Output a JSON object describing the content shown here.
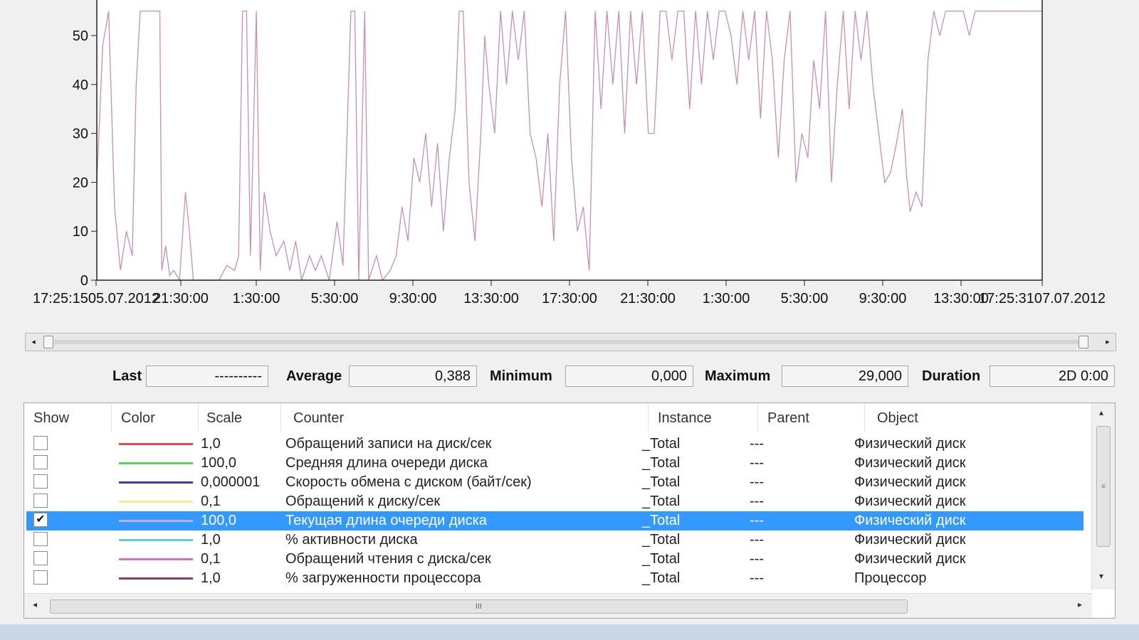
{
  "chart": {
    "y_ticks": [
      "0",
      "10",
      "20",
      "30",
      "40",
      "50"
    ],
    "x_ticks": [
      "17:25:1505.07.2012",
      "21:30:00",
      "1:30:00",
      "5:30:00",
      "9:30:00",
      "13:30:00",
      "17:30:00",
      "21:30:00",
      "1:30:00",
      "5:30:00",
      "9:30:00",
      "13:30:00",
      "17:25:3107.07.2012"
    ],
    "line_color": "#c58fb6"
  },
  "chart_data": {
    "type": "line",
    "ylim": [
      0,
      55
    ],
    "xlim": [
      0,
      48
    ],
    "x_unit": "hours since 17:25:15 05.07.2012",
    "series": [
      {
        "values": [
          [
            0.0,
            20
          ],
          [
            0.3,
            48
          ],
          [
            0.6,
            55
          ],
          [
            0.9,
            15
          ],
          [
            1.2,
            2
          ],
          [
            1.5,
            10
          ],
          [
            1.8,
            5
          ],
          [
            2.0,
            40
          ],
          [
            2.2,
            55
          ],
          [
            2.5,
            55
          ],
          [
            2.9,
            55
          ],
          [
            3.2,
            55
          ],
          [
            3.3,
            2
          ],
          [
            3.5,
            7
          ],
          [
            3.7,
            1
          ],
          [
            3.9,
            2
          ],
          [
            4.2,
            0
          ],
          [
            4.5,
            18
          ],
          [
            4.7,
            10
          ],
          [
            4.9,
            0
          ],
          [
            5.5,
            0
          ],
          [
            6.2,
            0
          ],
          [
            6.6,
            3
          ],
          [
            7.0,
            2
          ],
          [
            7.2,
            5
          ],
          [
            7.4,
            55
          ],
          [
            7.6,
            55
          ],
          [
            7.8,
            5
          ],
          [
            8.1,
            55
          ],
          [
            8.3,
            2
          ],
          [
            8.5,
            18
          ],
          [
            8.8,
            10
          ],
          [
            9.1,
            5
          ],
          [
            9.5,
            8
          ],
          [
            9.8,
            2
          ],
          [
            10.1,
            8
          ],
          [
            10.4,
            0
          ],
          [
            10.8,
            5
          ],
          [
            11.1,
            2
          ],
          [
            11.4,
            5
          ],
          [
            11.8,
            0
          ],
          [
            12.2,
            12
          ],
          [
            12.5,
            3
          ],
          [
            12.9,
            55
          ],
          [
            13.1,
            55
          ],
          [
            13.3,
            0
          ],
          [
            13.6,
            55
          ],
          [
            13.8,
            0
          ],
          [
            14.2,
            5
          ],
          [
            14.5,
            0
          ],
          [
            14.9,
            2
          ],
          [
            15.2,
            5
          ],
          [
            15.5,
            15
          ],
          [
            15.8,
            8
          ],
          [
            16.1,
            25
          ],
          [
            16.4,
            20
          ],
          [
            16.7,
            30
          ],
          [
            17.0,
            15
          ],
          [
            17.3,
            28
          ],
          [
            17.6,
            10
          ],
          [
            17.9,
            25
          ],
          [
            18.2,
            35
          ],
          [
            18.4,
            55
          ],
          [
            18.6,
            55
          ],
          [
            18.9,
            20
          ],
          [
            19.2,
            8
          ],
          [
            19.5,
            30
          ],
          [
            19.7,
            50
          ],
          [
            19.9,
            40
          ],
          [
            20.2,
            30
          ],
          [
            20.5,
            55
          ],
          [
            20.8,
            40
          ],
          [
            21.1,
            55
          ],
          [
            21.4,
            45
          ],
          [
            21.7,
            55
          ],
          [
            22.0,
            30
          ],
          [
            22.3,
            25
          ],
          [
            22.6,
            15
          ],
          [
            22.9,
            30
          ],
          [
            23.2,
            8
          ],
          [
            23.5,
            40
          ],
          [
            23.8,
            55
          ],
          [
            24.1,
            25
          ],
          [
            24.4,
            10
          ],
          [
            24.7,
            15
          ],
          [
            25.0,
            2
          ],
          [
            25.3,
            55
          ],
          [
            25.6,
            35
          ],
          [
            25.9,
            55
          ],
          [
            26.2,
            40
          ],
          [
            26.5,
            55
          ],
          [
            26.8,
            30
          ],
          [
            27.1,
            55
          ],
          [
            27.4,
            40
          ],
          [
            27.7,
            55
          ],
          [
            28.0,
            30
          ],
          [
            28.3,
            30
          ],
          [
            28.6,
            55
          ],
          [
            28.9,
            55
          ],
          [
            29.2,
            45
          ],
          [
            29.5,
            55
          ],
          [
            29.8,
            55
          ],
          [
            30.1,
            35
          ],
          [
            30.4,
            55
          ],
          [
            30.7,
            40
          ],
          [
            31.0,
            55
          ],
          [
            31.3,
            45
          ],
          [
            31.6,
            55
          ],
          [
            31.9,
            55
          ],
          [
            32.2,
            50
          ],
          [
            32.5,
            40
          ],
          [
            32.8,
            55
          ],
          [
            33.1,
            45
          ],
          [
            33.4,
            55
          ],
          [
            33.7,
            33
          ],
          [
            34.0,
            55
          ],
          [
            34.3,
            45
          ],
          [
            34.6,
            25
          ],
          [
            34.9,
            45
          ],
          [
            35.2,
            55
          ],
          [
            35.5,
            20
          ],
          [
            35.8,
            30
          ],
          [
            36.1,
            25
          ],
          [
            36.4,
            45
          ],
          [
            36.7,
            35
          ],
          [
            37.0,
            55
          ],
          [
            37.3,
            20
          ],
          [
            37.6,
            40
          ],
          [
            37.9,
            55
          ],
          [
            38.2,
            35
          ],
          [
            38.5,
            55
          ],
          [
            38.8,
            45
          ],
          [
            39.1,
            55
          ],
          [
            39.4,
            40
          ],
          [
            39.7,
            30
          ],
          [
            40.0,
            20
          ],
          [
            40.3,
            22
          ],
          [
            40.6,
            28
          ],
          [
            40.9,
            35
          ],
          [
            41.1,
            22
          ],
          [
            41.3,
            14
          ],
          [
            41.6,
            18
          ],
          [
            41.9,
            15
          ],
          [
            42.2,
            45
          ],
          [
            42.5,
            55
          ],
          [
            42.8,
            50
          ],
          [
            43.1,
            55
          ],
          [
            43.4,
            55
          ],
          [
            43.7,
            55
          ],
          [
            44.0,
            55
          ],
          [
            44.3,
            50
          ],
          [
            44.6,
            55
          ],
          [
            45.0,
            55
          ],
          [
            45.5,
            55
          ],
          [
            46.0,
            55
          ],
          [
            46.5,
            55
          ],
          [
            47.0,
            55
          ],
          [
            47.5,
            55
          ],
          [
            48.0,
            55
          ]
        ]
      }
    ]
  },
  "stats": {
    "last_label": "Last",
    "last_value": "----------",
    "average_label": "Average",
    "average_value": "0,388",
    "minimum_label": "Minimum",
    "minimum_value": "0,000",
    "maximum_label": "Maximum",
    "maximum_value": "29,000",
    "duration_label": "Duration",
    "duration_value": "2D 0:00"
  },
  "legend": {
    "headers": {
      "show": "Show",
      "color": "Color",
      "scale": "Scale",
      "counter": "Counter",
      "instance": "Instance",
      "parent": "Parent",
      "object": "Object"
    },
    "rows": [
      {
        "checked": false,
        "color": "#e05050",
        "scale": "1,0",
        "counter": "Обращений записи на диск/сек",
        "instance": "_Total",
        "parent": "---",
        "object": "Физический диск"
      },
      {
        "checked": false,
        "color": "#60d060",
        "scale": "100,0",
        "counter": "Средняя длина очереди диска",
        "instance": "_Total",
        "parent": "---",
        "object": "Физический диск"
      },
      {
        "checked": false,
        "color": "#3a3aa0",
        "scale": "0,000001",
        "counter": "Скорость обмена с диском (байт/сек)",
        "instance": "_Total",
        "parent": "---",
        "object": "Физический диск"
      },
      {
        "checked": false,
        "color": "#f0f090",
        "scale": "0,1",
        "counter": "Обращений к диску/сек",
        "instance": "_Total",
        "parent": "---",
        "object": "Физический диск"
      },
      {
        "checked": true,
        "color": "#c8a8e8",
        "scale": "100,0",
        "counter": "Текущая длина очереди диска",
        "instance": "_Total",
        "parent": "---",
        "object": "Физический диск"
      },
      {
        "checked": false,
        "color": "#60d0d8",
        "scale": "1,0",
        "counter": "% активности диска",
        "instance": "_Total",
        "parent": "---",
        "object": "Физический диск"
      },
      {
        "checked": false,
        "color": "#d070c8",
        "scale": "0,1",
        "counter": "Обращений чтения с диска/сек",
        "instance": "_Total",
        "parent": "---",
        "object": "Физический диск"
      },
      {
        "checked": false,
        "color": "#8a3a7a",
        "scale": "1,0",
        "counter": "% загруженности процессора",
        "instance": "_Total",
        "parent": "---",
        "object": "Процессор"
      }
    ],
    "selected_index": 4
  },
  "icons": {
    "scroll_left": "◂",
    "scroll_right": "▸",
    "scroll_up": "▴",
    "scroll_down": "▾",
    "check": "✔",
    "grip_v": "≡",
    "grip_h": "III"
  }
}
